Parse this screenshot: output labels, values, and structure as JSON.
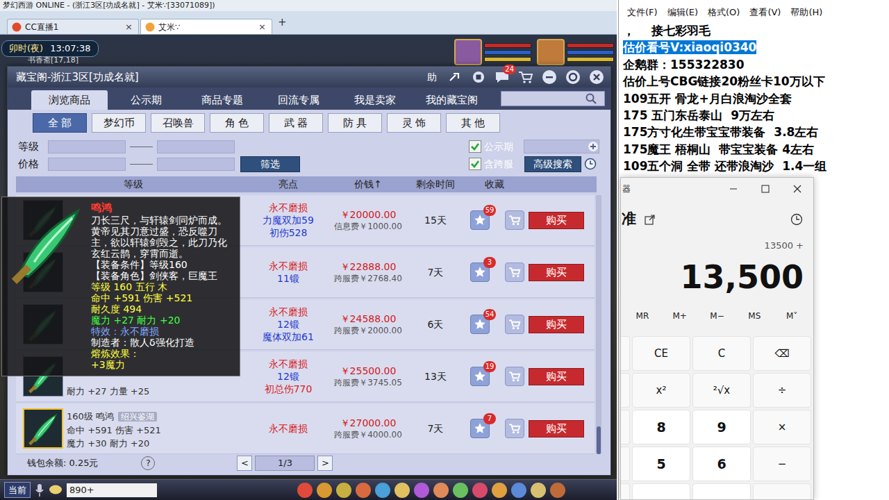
{
  "window": {
    "title": "梦幻西游 ONLINE - (浙江3区[功成名就] - 艾米∵[33071089])"
  },
  "browser_tabs": [
    {
      "label": "CC直播1",
      "close": "×",
      "selected": false
    },
    {
      "label": "艾米∵",
      "close": "×",
      "selected": true
    }
  ],
  "new_tab": "+",
  "game": {
    "clock": "卯时(夜)",
    "time": "13:07:38",
    "location": "书香斋[17,18]",
    "channel": "当前",
    "chat_input": "890+"
  },
  "market": {
    "title": "藏宝阁-浙江3区[功成名就]",
    "help": "助",
    "chat_badge": "24",
    "tabs": [
      {
        "label": "浏览商品",
        "selected": true
      },
      {
        "label": "公示期",
        "selected": false
      },
      {
        "label": "商品专题",
        "selected": false
      },
      {
        "label": "回流专属",
        "selected": false
      },
      {
        "label": "我是卖家",
        "selected": false
      },
      {
        "label": "我的藏宝阁",
        "selected": false
      }
    ],
    "categories": [
      {
        "label": "全 部",
        "selected": true
      },
      {
        "label": "梦幻币",
        "selected": false
      },
      {
        "label": "召唤兽",
        "selected": false
      },
      {
        "label": "角 色",
        "selected": false
      },
      {
        "label": "武 器",
        "selected": false
      },
      {
        "label": "防 具",
        "selected": false
      },
      {
        "label": "灵 饰",
        "selected": false
      },
      {
        "label": "其 他",
        "selected": false
      }
    ],
    "filters": {
      "level": "等级",
      "price": "价格",
      "filter_button": "筛选",
      "checkboxes": [
        {
          "label": "公示期",
          "checked": true
        },
        {
          "label": "含跨服",
          "checked": true
        }
      ],
      "advanced": "高级搜索"
    },
    "table": {
      "columns": [
        "等级",
        "亮点",
        "价钱↑",
        "剩余时间",
        "收藏"
      ],
      "rows": [
        {
          "lines": [],
          "tag": "",
          "highlights": [
            {
              "text": "永不磨损",
              "color": "#d81a1a"
            },
            {
              "text": "力魔双加59",
              "color": "#1f3bd0"
            },
            {
              "text": "初伤528",
              "color": "#1f3bd0"
            }
          ],
          "price": "￥20000.00",
          "fee": "信息费￥1000.00",
          "time": "15天",
          "favorites": "59",
          "buy": "购买",
          "selected": false
        },
        {
          "lines": [],
          "tag": "",
          "highlights": [
            {
              "text": "永不磨损",
              "color": "#d81a1a"
            },
            {
              "text": "11锻",
              "color": "#1f3bd0"
            }
          ],
          "price": "￥22888.00",
          "fee": "跨服费￥2768.40",
          "time": "7天",
          "favorites": "3",
          "buy": "购买",
          "selected": false
        },
        {
          "lines": [],
          "tag": "",
          "highlights": [
            {
              "text": "永不磨损",
              "color": "#d81a1a"
            },
            {
              "text": "12锻",
              "color": "#1f3bd0"
            },
            {
              "text": "魔体双加61",
              "color": "#1f3bd0"
            }
          ],
          "price": "￥24588.00",
          "fee": "跨服费￥2000.00",
          "time": "6天",
          "favorites": "54",
          "buy": "购买",
          "selected": false
        },
        {
          "lines": [
            "耐力 +27 力量 +25"
          ],
          "tag": "",
          "highlights": [
            {
              "text": "永不磨损",
              "color": "#d81a1a"
            },
            {
              "text": "12锻",
              "color": "#1f3bd0"
            },
            {
              "text": "初总伤770",
              "color": "#d81a1a"
            }
          ],
          "price": "￥25500.00",
          "fee": "跨服费￥3745.05",
          "time": "13天",
          "favorites": "19",
          "buy": "购买",
          "selected": false
        },
        {
          "lines": [
            "160级 鸣鸿",
            "命中 +591 伤害 +521",
            "魔力 +30 耐力 +20"
          ],
          "tag": "绍兴鉴湖",
          "highlights": [
            {
              "text": "永不磨损",
              "color": "#d81a1a"
            }
          ],
          "price": "￥27000.00",
          "fee": "跨服费￥4000.00",
          "time": "7天",
          "favorites": "7",
          "buy": "购买",
          "selected": true
        }
      ]
    },
    "wallet": "钱包余额: 0.25元",
    "help_mark": "?",
    "pager": {
      "prev": "<",
      "page": "1/3",
      "next": ">"
    }
  },
  "tooltip": {
    "name": "鸣鸿",
    "lines": [
      {
        "text": "刀长三尺，与轩辕剑同炉而成。黄帝见其刀意过盛，恐反噬刀主，欲以轩辕剑毁之，此刀乃化玄红云鹊，穿霄而逝。",
        "color": "#ffffff"
      },
      {
        "text": "【装备条件】等级160",
        "color": "#ffffff"
      },
      {
        "text": "【装备角色】剑侠客，巨魔王",
        "color": "#ffffff"
      },
      {
        "text": "等级 160  五行 木",
        "color": "#ffff40"
      },
      {
        "text": "命中 +591 伤害 +521",
        "color": "#ffff40"
      },
      {
        "text": "耐久度 494",
        "color": "#ffff40"
      },
      {
        "text": "魔力 +27 耐力 +20",
        "color": "#40ff40"
      },
      {
        "text": "特效：永不磨损",
        "color": "#82a8ff"
      },
      {
        "text": "制造者：散人δ强化打造",
        "color": "#ffffff"
      },
      {
        "text": "熔炼效果：",
        "color": "#ffff40"
      },
      {
        "text": "+3魔力",
        "color": "#ffff40"
      }
    ]
  },
  "notepad": {
    "menu": [
      "文件(F)",
      "编辑(E)",
      "格式(O)",
      "查看(V)",
      "帮助(H)"
    ],
    "lines": [
      {
        "text": "，    接七彩羽毛",
        "selected": false
      },
      {
        "text": "估价看号V:xiaoqi0340",
        "selected": true
      },
      {
        "text": "企鹅群：155322830",
        "selected": false
      },
      {
        "text": "估价上号CBG链接20粉丝卡10万以下",
        "selected": false
      },
      {
        "text": "109五开 骨龙+月白浪淘沙全套",
        "selected": false
      },
      {
        "text": "175 五门东岳泰山  9万左右",
        "selected": false
      },
      {
        "text": "175方寸化生带宝宝带装备  3.8左右",
        "selected": false
      },
      {
        "text": "175魔王 梧桐山  带宝宝装备 4左右",
        "selected": false
      },
      {
        "text": "109五个洞 全带 还带浪淘沙  1.4一组",
        "selected": false
      }
    ]
  },
  "calculator": {
    "title": "器",
    "mode": "准",
    "expression": "13500 +",
    "display": "13,500",
    "memory": [
      "MR",
      "M+",
      "M−",
      "MS",
      "M˅"
    ],
    "keys": [
      [
        {
          "label": "CE",
          "kind": "fn"
        },
        {
          "label": "C",
          "kind": "fn"
        },
        {
          "label": "⌫",
          "kind": "fn"
        }
      ],
      [
        {
          "label": "x²",
          "kind": "fn"
        },
        {
          "label": "²√x",
          "kind": "fn"
        },
        {
          "label": "÷",
          "kind": "fn"
        }
      ],
      [
        {
          "label": "8",
          "kind": "num"
        },
        {
          "label": "9",
          "kind": "num"
        },
        {
          "label": "×",
          "kind": "fn"
        }
      ],
      [
        {
          "label": "5",
          "kind": "num"
        },
        {
          "label": "6",
          "kind": "num"
        },
        {
          "label": "−",
          "kind": "fn"
        }
      ],
      [
        {
          "label": "",
          "kind": "num"
        },
        {
          "label": "",
          "kind": "num"
        },
        {
          "label": "",
          "kind": "fn"
        }
      ]
    ]
  }
}
